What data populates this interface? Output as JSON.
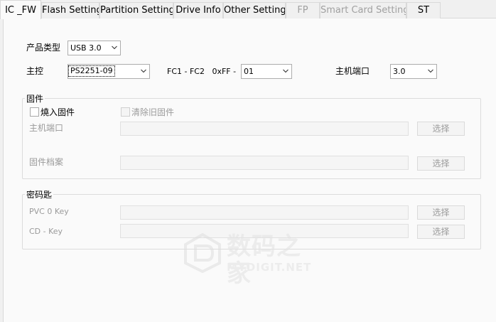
{
  "tabs": [
    {
      "label": "IC _FW",
      "active": true,
      "enabled": true
    },
    {
      "label": "Flash Setting",
      "active": false,
      "enabled": true
    },
    {
      "label": "Partition Setting",
      "active": false,
      "enabled": true
    },
    {
      "label": "Drive Info",
      "active": false,
      "enabled": true
    },
    {
      "label": "Other Setting",
      "active": false,
      "enabled": true
    },
    {
      "label": "FP",
      "active": false,
      "enabled": false
    },
    {
      "label": "Smart Card Setting",
      "active": false,
      "enabled": false
    },
    {
      "label": "ST",
      "active": false,
      "enabled": true
    }
  ],
  "product_type": {
    "label": "产品类型",
    "value": "USB 3.0"
  },
  "controller": {
    "label": "主控",
    "value": "PS2251-09"
  },
  "fc": {
    "label": "FC1 - FC2   0xFF -",
    "value": "01"
  },
  "host_port": {
    "label": "主机端口",
    "value": "3.0"
  },
  "firmware_group": {
    "title": "固件",
    "burn_label": "燒入固件",
    "burn_checked": false,
    "clear_label": "清除旧固件",
    "clear_checked": false,
    "host_port_label": "主机端口",
    "host_port_button": "选择",
    "fw_file_label": "固件档案",
    "fw_file_button": "选择"
  },
  "key_group": {
    "title": "密码匙",
    "pvc_label": "PVC 0 Key",
    "pvc_button": "选择",
    "cd_label": "CD - Key",
    "cd_button": "选择"
  },
  "watermark": {
    "title": "数码之家",
    "subtitle": "MYDIGIT.NET"
  },
  "icons": {
    "dropdown": "chevron-down-icon",
    "watermark_logo": "house-logo-icon"
  }
}
